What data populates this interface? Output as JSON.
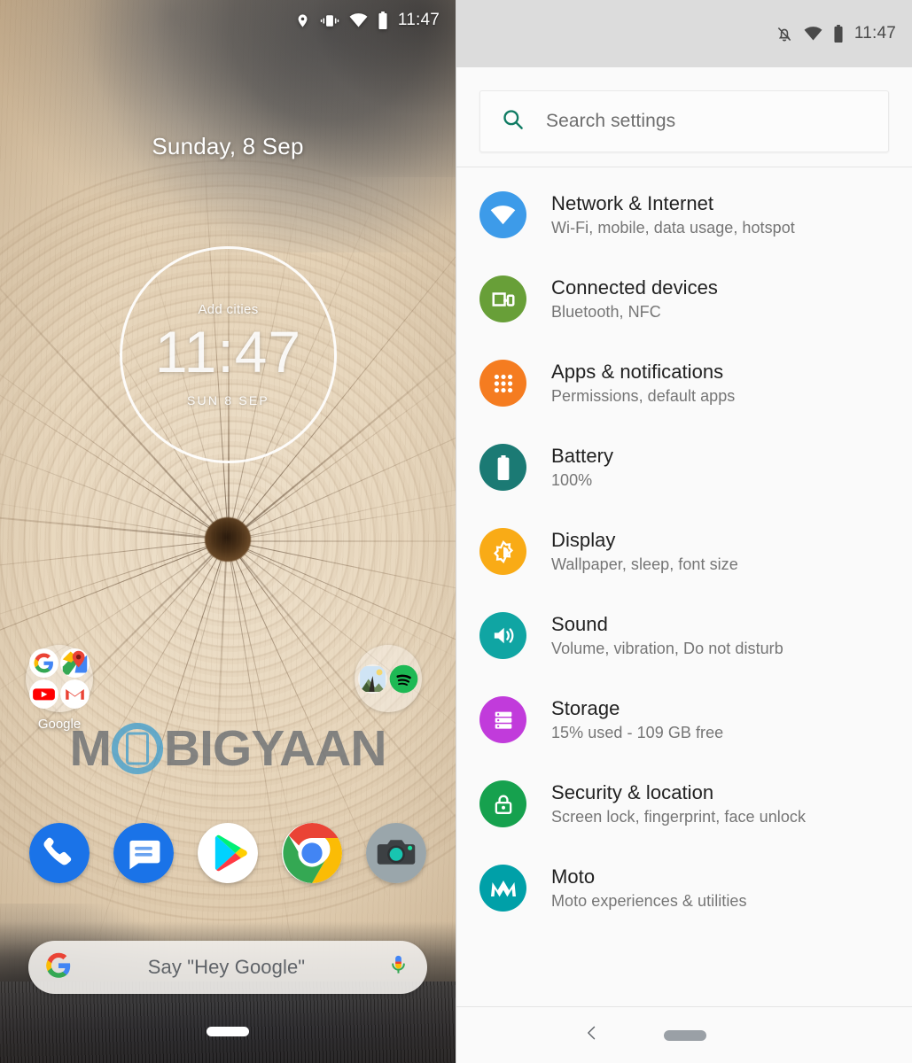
{
  "home": {
    "status_bar": {
      "time": "11:47",
      "icons": [
        "location-pin-icon",
        "vibrate-icon",
        "wifi-icon",
        "battery-icon"
      ]
    },
    "date_header": "Sunday, 8 Sep",
    "clock_widget": {
      "add_cities_label": "Add cities",
      "time": "11:47",
      "date": "SUN  8  SEP"
    },
    "watermark": {
      "before": "M",
      "logo": "mobigyaan-phone-logo",
      "after": "BIGYAAN"
    },
    "folders": [
      {
        "label": "Google",
        "apps": [
          "google-g-icon",
          "google-maps-icon",
          "youtube-icon",
          "gmail-icon"
        ]
      },
      {
        "label": "",
        "apps": [
          "photos-gallery-icon",
          "spotify-icon"
        ]
      }
    ],
    "dock": [
      {
        "name": "phone-app-icon",
        "label": "Phone"
      },
      {
        "name": "messages-app-icon",
        "label": "Messages"
      },
      {
        "name": "play-store-app-icon",
        "label": "Play Store"
      },
      {
        "name": "chrome-app-icon",
        "label": "Chrome"
      },
      {
        "name": "camera-app-icon",
        "label": "Camera"
      }
    ],
    "google_search": {
      "logo": "google-g-icon",
      "hint": "Say \"Hey Google\"",
      "mic": "microphone-icon"
    },
    "nav": {
      "home_pill": "home-indicator-pill"
    }
  },
  "settings": {
    "status_bar": {
      "time": "11:47",
      "icons": [
        "notifications-off-icon",
        "wifi-icon",
        "battery-icon"
      ]
    },
    "search": {
      "placeholder": "Search settings",
      "icon": "search-icon",
      "icon_color": "#0f7b63"
    },
    "items": [
      {
        "title": "Network & Internet",
        "subtitle": "Wi-Fi, mobile, data usage, hotspot",
        "icon": "wifi-icon",
        "color": "#3D9BE9"
      },
      {
        "title": "Connected devices",
        "subtitle": "Bluetooth, NFC",
        "icon": "cast-devices-icon",
        "color": "#689F38"
      },
      {
        "title": "Apps & notifications",
        "subtitle": "Permissions, default apps",
        "icon": "app-grid-icon",
        "color": "#F57C20"
      },
      {
        "title": "Battery",
        "subtitle": "100%",
        "icon": "battery-icon",
        "color": "#1B7A74"
      },
      {
        "title": "Display",
        "subtitle": "Wallpaper, sleep, font size",
        "icon": "brightness-icon",
        "color": "#F9AB16"
      },
      {
        "title": "Sound",
        "subtitle": "Volume, vibration, Do not disturb",
        "icon": "volume-icon",
        "color": "#10A5A3"
      },
      {
        "title": "Storage",
        "subtitle": "15% used - 109 GB free",
        "icon": "storage-stack-icon",
        "color": "#C13BDB"
      },
      {
        "title": "Security & location",
        "subtitle": "Screen lock, fingerprint, face unlock",
        "icon": "lock-icon",
        "color": "#16A14E"
      },
      {
        "title": "Moto",
        "subtitle": "Moto experiences & utilities",
        "icon": "motorola-icon",
        "color": "#00A0A8"
      }
    ],
    "nav": {
      "back": "back-chevron-icon",
      "home_pill": "home-indicator-pill"
    }
  }
}
